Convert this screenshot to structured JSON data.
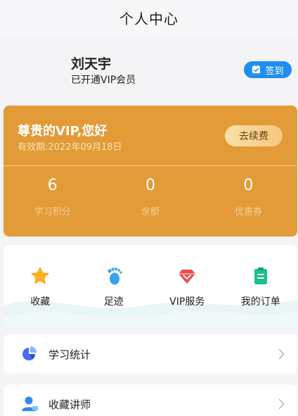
{
  "header": {
    "title": "个人中心"
  },
  "profile": {
    "name": "刘天宇",
    "vip_status": "已开通VIP会员",
    "signin_label": "签到"
  },
  "vip_card": {
    "greeting": "尊贵的VIP,您好",
    "expiry": "有效期:2022年09月18日",
    "renew_label": "去续费",
    "stats": [
      {
        "value": "6",
        "label": "学习积分"
      },
      {
        "value": "0",
        "label": "余额"
      },
      {
        "value": "0",
        "label": "优惠券"
      }
    ]
  },
  "shortcuts": [
    {
      "label": "收藏",
      "icon": "star-icon"
    },
    {
      "label": "足迹",
      "icon": "footprint-icon"
    },
    {
      "label": "VIP服务",
      "icon": "diamond-icon"
    },
    {
      "label": "我的订单",
      "icon": "order-icon"
    }
  ],
  "menu": [
    {
      "label": "学习统计",
      "icon": "pie-chart-icon"
    },
    {
      "label": "收藏讲师",
      "icon": "user-icon"
    }
  ],
  "colors": {
    "accent_blue": "#1f8ef2",
    "vip_orange": "#e29b37"
  }
}
